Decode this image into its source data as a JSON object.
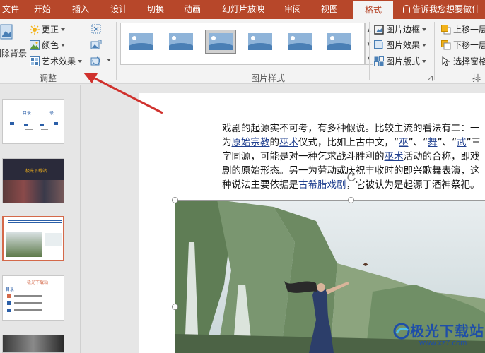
{
  "tabs": [
    {
      "label": "文件",
      "active": false
    },
    {
      "label": "开始",
      "active": false
    },
    {
      "label": "插入",
      "active": false
    },
    {
      "label": "设计",
      "active": false
    },
    {
      "label": "切换",
      "active": false
    },
    {
      "label": "动画",
      "active": false
    },
    {
      "label": "幻灯片放映",
      "active": false
    },
    {
      "label": "审阅",
      "active": false
    },
    {
      "label": "视图",
      "active": false
    },
    {
      "label": "格式",
      "active": true
    }
  ],
  "tellme": "告诉我您想要做什",
  "ribbon": {
    "remove_bg": "删除背景",
    "adjust": {
      "corrections": "更正",
      "color": "颜色",
      "artistic": "艺术效果",
      "label": "调整"
    },
    "picture_styles_label": "图片样式",
    "picture_border": "图片边框",
    "picture_effects": "图片效果",
    "picture_layout": "图片版式",
    "bring_forward": "上移一层",
    "send_backward": "下移一层",
    "selection_pane": "选择窗格",
    "arrange_label": "排列"
  },
  "slides": [
    {
      "number": "",
      "title": "目录",
      "subtitle": "录"
    },
    {
      "number": "",
      "title": "极光下载站"
    },
    {
      "number": "",
      "title": ""
    },
    {
      "number": "",
      "title": "极光下载站",
      "subtitle": "目录"
    },
    {
      "number": "",
      "title": ""
    }
  ],
  "slide_text": {
    "p1": "戏剧的起源实不可考，有多种假说。比较主流的看法有二：一为",
    "link1": "原始宗教",
    "p2": "的",
    "link2": "巫术",
    "p3": "仪式，比如上古中文，“",
    "link3": "巫",
    "p4": "”、“",
    "link4": "舞",
    "p5": "”、“",
    "link5": "武",
    "p6": "”三字同源，可能是对一种乞求战斗胜利的",
    "link6": "巫术",
    "p7": "活动的合称，即戏剧的原始形态。另一为劳动或庆祝丰收时的即兴歌舞表演，这种说法主要依据是",
    "link7": "古希腊戏剧",
    "p8": "，它被认为是起源于酒神祭祀。"
  },
  "watermark": {
    "name": "极光下载站",
    "url": "www.xz7.com"
  },
  "colors": {
    "accent": "#b7472a",
    "ribbon": "#f3f3f3",
    "arrow": "#d0312d"
  }
}
